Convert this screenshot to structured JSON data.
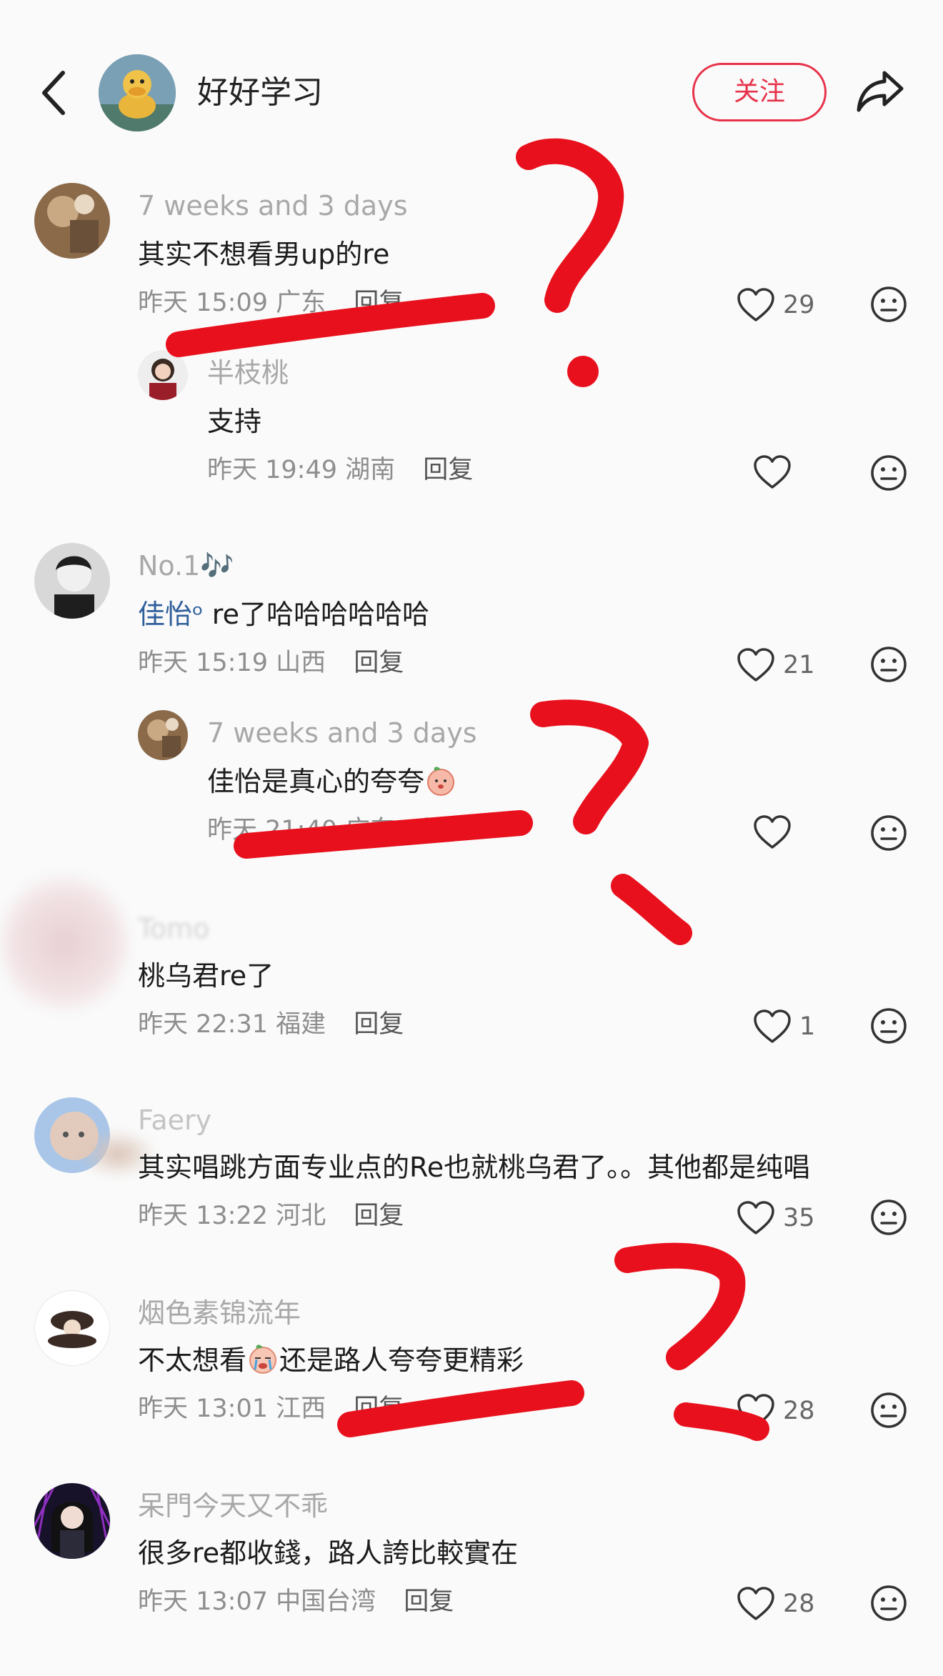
{
  "header": {
    "title": "好好学习",
    "follow_label": "关注"
  },
  "comments": [
    {
      "username": "7 weeks and 3 days",
      "text": "其实不想看男up的re",
      "time": "昨天 15:09",
      "location": "广东",
      "reply_label": "回复",
      "likes": "29",
      "replies": [
        {
          "username": "半枝桃",
          "text": "支持",
          "time": "昨天 19:49",
          "location": "湖南",
          "reply_label": "回复",
          "likes": ""
        }
      ]
    },
    {
      "username": "No.1🎶",
      "mention": "佳怡ᵒ",
      "text": " re了哈哈哈哈哈哈",
      "time": "昨天 15:19",
      "location": "山西",
      "reply_label": "回复",
      "likes": "21",
      "replies": [
        {
          "username": "7 weeks and 3 days",
          "text": "佳怡是真心的夸夸",
          "time": "昨天 21:40",
          "location": "广东",
          "reply_label": "回复",
          "likes": ""
        }
      ]
    },
    {
      "username": "Tomo",
      "text": "桃乌君re了",
      "time": "昨天 22:31",
      "location": "福建",
      "reply_label": "回复",
      "likes": "1"
    },
    {
      "username": "Faery",
      "text": "其实唱跳方面专业点的Re也就桃乌君了。。其他都是纯唱",
      "time": "昨天 13:22",
      "location": "河北",
      "reply_label": "回复",
      "likes": "35"
    },
    {
      "username": "烟色素锦流年",
      "text_a": "不太想看",
      "text_b": "还是路人夸夸更精彩",
      "time": "昨天 13:01",
      "location": "江西",
      "reply_label": "回复",
      "likes": "28"
    },
    {
      "username": "呆門今天又不乖",
      "text": "很多re都收錢，路人誇比較實在",
      "time": "昨天 13:07",
      "location": "中国台湾",
      "reply_label": "回复",
      "likes": "28"
    }
  ],
  "annotation_color": "#e8101c",
  "accent_color": "#e7324a"
}
